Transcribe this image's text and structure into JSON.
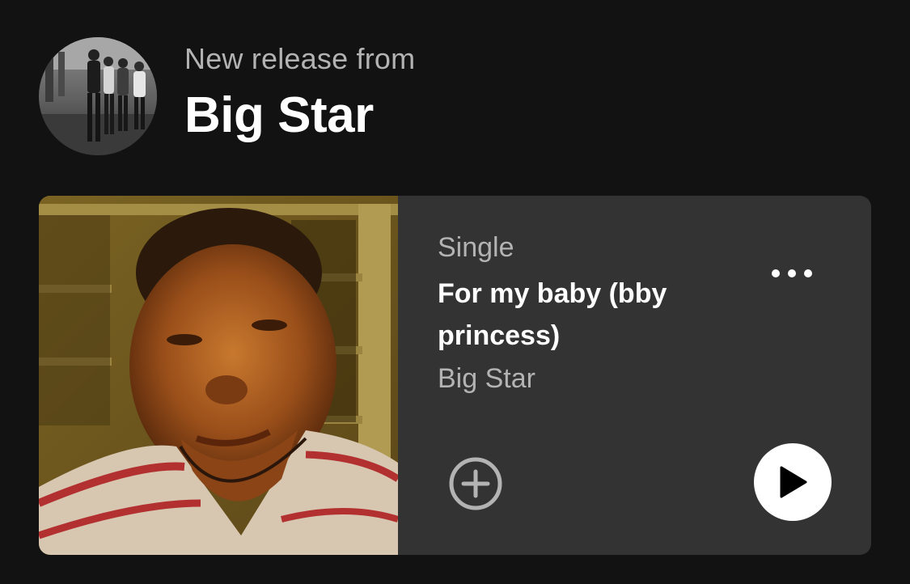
{
  "header": {
    "eyebrow": "New release from",
    "artist_name": "Big Star",
    "avatar_icon": "artist-photo"
  },
  "release": {
    "type": "Single",
    "title": "For my baby (bby princess)",
    "artist": "Big Star",
    "cover_icon": "album-cover-photo"
  },
  "actions": {
    "more_icon": "more-options-icon",
    "add_icon": "add-circle-icon",
    "play_icon": "play-icon"
  },
  "colors": {
    "background": "#121212",
    "card": "#333333",
    "primary_text": "#ffffff",
    "secondary_text": "#b3b3b3",
    "play_button": "#ffffff"
  }
}
